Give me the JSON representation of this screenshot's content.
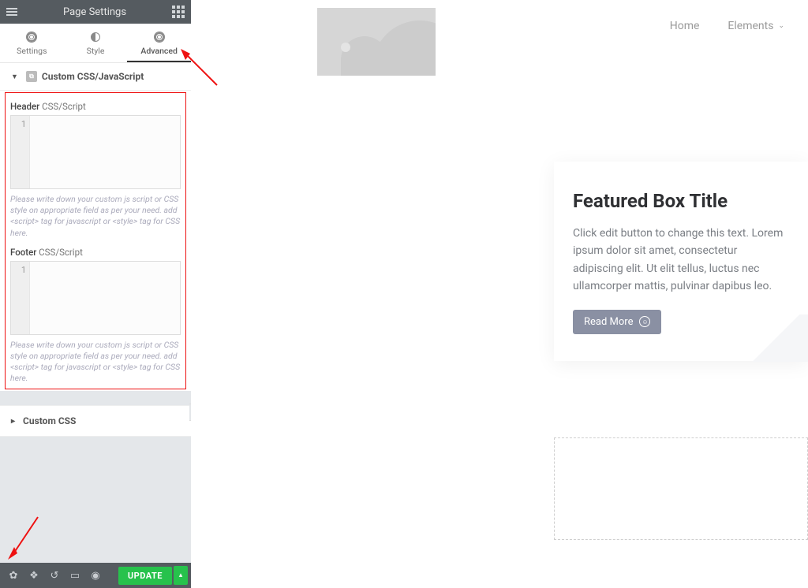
{
  "header": {
    "title": "Page Settings"
  },
  "tabs": [
    {
      "label": "Settings"
    },
    {
      "label": "Style"
    },
    {
      "label": "Advanced"
    }
  ],
  "sections": {
    "custom_script": {
      "title": "Custom CSS/JavaScript",
      "header_field": {
        "label_dark": "Header",
        "label_light": " CSS/Script",
        "line_no": "1",
        "hint": "Please write down your custom js script or CSS style on appropriate field as per your need. add <script> tag for javascript or <style> tag for CSS here."
      },
      "footer_field": {
        "label_dark": "Footer",
        "label_light": " CSS/Script",
        "line_no": "1",
        "hint": "Please write down your custom js script or CSS style on appropriate field as per your need. add <script> tag for javascript or <style> tag for CSS here."
      }
    },
    "custom_css": {
      "title": "Custom CSS"
    }
  },
  "footer": {
    "update": "UPDATE"
  },
  "nav": {
    "home": "Home",
    "elements": "Elements"
  },
  "card": {
    "title": "Featured Box Title",
    "body": "Click edit button to change this text. Lorem ipsum dolor sit amet, consectetur adipiscing elit. Ut elit tellus, luctus nec ullamcorper mattis, pulvinar dapibus leo.",
    "btn": "Read More"
  }
}
